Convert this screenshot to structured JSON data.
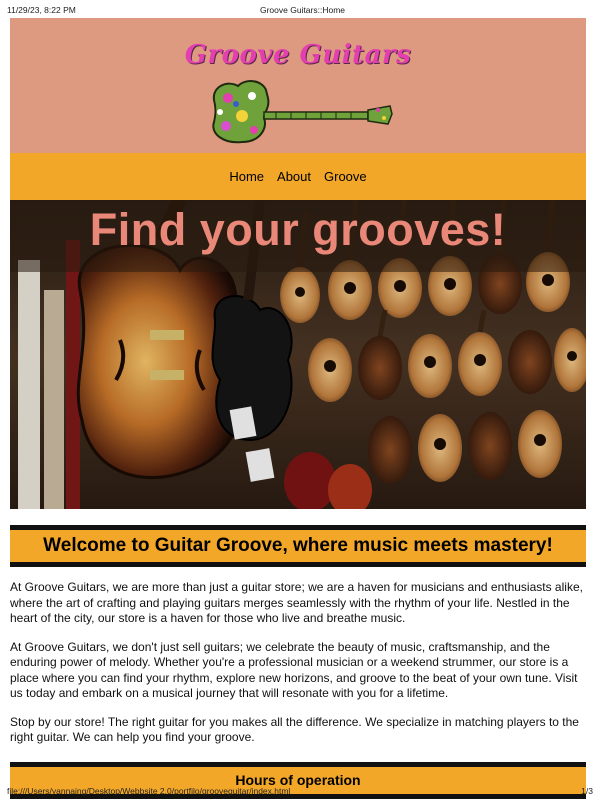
{
  "print": {
    "timestamp": "11/29/23, 8:22 PM",
    "page_title": "Groove Guitars::Home",
    "url": "file:///Users/yannaing/Desktop/Webbsite 2.0/portfilo/grooveguitar/index.html",
    "page_number": "1/3"
  },
  "logo": {
    "text": "Groove Guitars"
  },
  "nav": {
    "items": [
      "Home",
      "About",
      "Groove"
    ]
  },
  "hero": {
    "title": "Find your grooves!"
  },
  "welcome": {
    "heading": "Welcome to Guitar Groove, where music meets mastery!"
  },
  "paragraphs": [
    "At Groove Guitars, we are more than just a guitar store; we are a haven for musicians and enthusiasts alike, where the art of crafting and playing guitars merges seamlessly with the rhythm of your life. Nestled in the heart of the city, our store is a haven for those who live and breathe music.",
    "At Groove Guitars, we don't just sell guitars; we celebrate the beauty of music, craftsmanship, and the enduring power of melody. Whether you're a professional musician or a weekend strummer, our store is a place where you can find your rhythm, explore new horizons, and groove to the beat of your own tune. Visit us today and embark on a musical journey that will resonate with you for a lifetime.",
    "Stop by our store! The right guitar for you makes all the difference. We specialize in matching players to the right guitar. We can help you find your groove."
  ],
  "hours": {
    "heading": "Hours of operation"
  },
  "colors": {
    "logo_bg": "#de9a80",
    "accent": "#f2a729",
    "hero_title": "#e98878",
    "logo_text": "#e33fb0"
  }
}
